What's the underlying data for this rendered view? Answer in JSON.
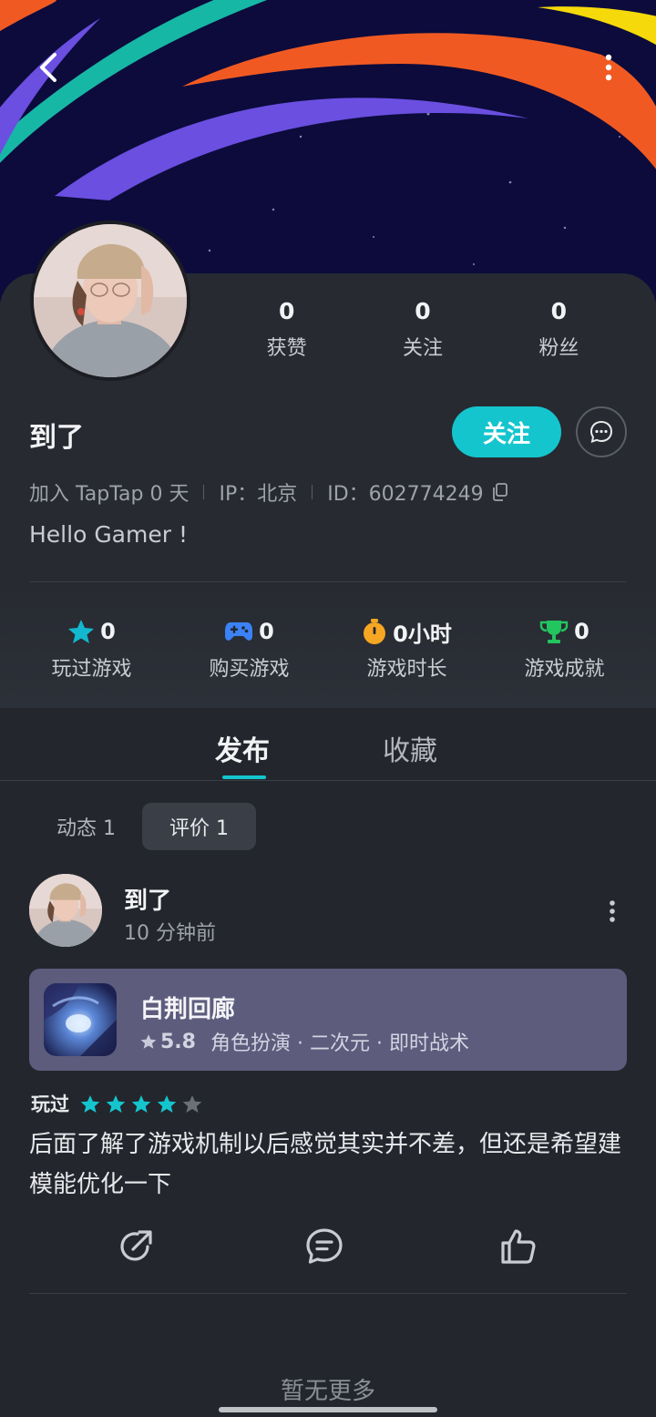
{
  "header": {
    "back_icon": "chevron-left-icon",
    "more_icon": "more-vertical-icon"
  },
  "profile": {
    "username": "到了",
    "stats": [
      {
        "value": "0",
        "label": "获赞"
      },
      {
        "value": "0",
        "label": "关注"
      },
      {
        "value": "0",
        "label": "粉丝"
      }
    ],
    "follow_label": "关注",
    "joined": "加入 TapTap 0 天",
    "ip": "IP：北京",
    "id": "ID：602774249",
    "bio": "Hello Gamer !"
  },
  "game_stats": [
    {
      "value": "0",
      "label": "玩过游戏",
      "icon": "star-icon",
      "color": "#12b8cf"
    },
    {
      "value": "0",
      "label": "购买游戏",
      "icon": "gamepad-icon",
      "color": "#3b82f6"
    },
    {
      "value": "0小时",
      "label": "游戏时长",
      "icon": "stopwatch-icon",
      "color": "#f5a623"
    },
    {
      "value": "0",
      "label": "游戏成就",
      "icon": "trophy-icon",
      "color": "#22c55e"
    }
  ],
  "tabs": [
    {
      "label": "发布",
      "active": true
    },
    {
      "label": "收藏",
      "active": false
    }
  ],
  "subtabs": [
    {
      "label": "动态 1",
      "active": false
    },
    {
      "label": "评价 1",
      "active": true
    }
  ],
  "post": {
    "author": "到了",
    "time": "10 分钟前",
    "game": {
      "title": "白荆回廊",
      "score": "5.8",
      "tags": "角色扮演 · 二次元 · 即时战术"
    },
    "played_label": "玩过",
    "rating": 4,
    "rating_max": 5,
    "text": "后面了解了游戏机制以后感觉其实并不差，但还是希望建模能优化一下"
  },
  "footer": {
    "no_more": "暂无更多"
  },
  "colors": {
    "accent": "#15c5ce",
    "background": "#23262d",
    "card": "#5d5c7d"
  }
}
